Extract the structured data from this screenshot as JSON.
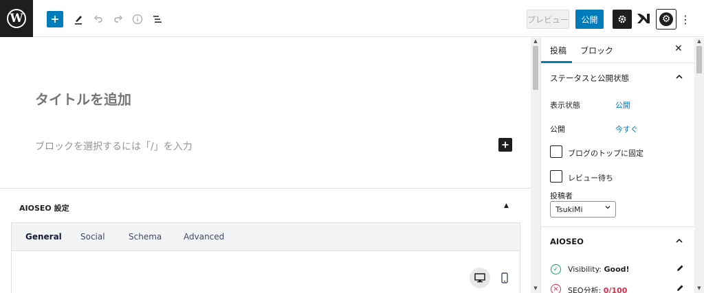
{
  "toolbar": {
    "wp_logo_icon": "wordpress-logo",
    "add_block_icon": "plus-icon",
    "tools_icon": "pencil-icon",
    "undo_icon": "undo-icon",
    "redo_icon": "redo-icon",
    "details_icon": "info-icon",
    "list_view_icon": "list-view-icon",
    "preview_label": "プレビュー",
    "publish_label": "公開",
    "settings_icon": "gear-icon",
    "more_icon": "more-vertical-icon",
    "accent_color": "#007cba"
  },
  "editor": {
    "title_placeholder": "タイトルを追加",
    "block_placeholder": "ブロックを選択するには「/」を入力"
  },
  "aioseo_box": {
    "title": "AIOSEO 設定",
    "collapse_glyph": "▲",
    "tabs": [
      "General",
      "Social",
      "Schema",
      "Advanced"
    ],
    "active_tab": "General"
  },
  "sidebar": {
    "tabs": [
      "投稿",
      "ブロック"
    ],
    "active_tab": "投稿",
    "status_panel": {
      "title": "ステータスと公開状態",
      "visibility_label": "表示状態",
      "visibility_value": "公開",
      "publish_label": "公開",
      "publish_value": "今すぐ",
      "sticky_label": "ブログのトップに固定",
      "pending_label": "レビュー待ち",
      "author_label": "投稿者",
      "author_value": "TsukiMi"
    },
    "aioseo_panel": {
      "title": "AIOSEO",
      "visibility_prefix": "Visibility: ",
      "visibility_value": "Good!",
      "seo_prefix": "SEO分析: ",
      "seo_value": "0/100",
      "good_color": "#00aa63",
      "bad_color": "#df2a4a"
    }
  }
}
